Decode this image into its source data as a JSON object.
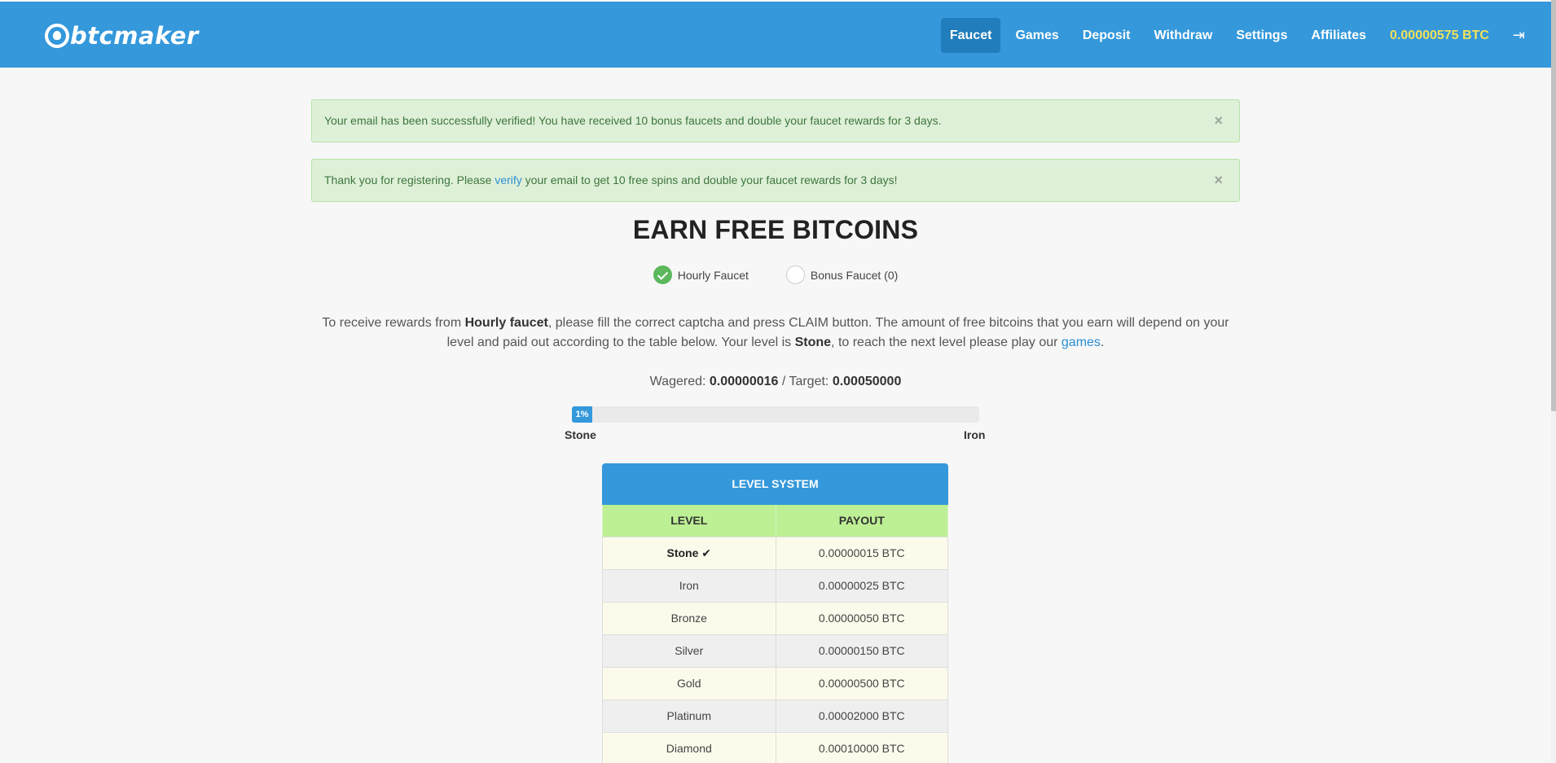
{
  "nav": {
    "logo_text": "btcmaker",
    "items": [
      {
        "label": "Faucet",
        "active": true
      },
      {
        "label": "Games",
        "active": false
      },
      {
        "label": "Deposit",
        "active": false
      },
      {
        "label": "Withdraw",
        "active": false
      },
      {
        "label": "Settings",
        "active": false
      },
      {
        "label": "Affiliates",
        "active": false
      }
    ],
    "balance": "0.00000575 BTC",
    "logout_icon": "sign-out-icon"
  },
  "alerts": {
    "verified": {
      "text": "Your email has been successfully verified! You have received 10 bonus faucets and double your faucet rewards for 3 days.",
      "close": "×"
    },
    "register": {
      "text_before": "Thank you for registering. Please ",
      "link": "verify",
      "text_after": " your email to get 10 free spins and double your faucet rewards for 3 days!",
      "close": "×"
    }
  },
  "title": "EARN FREE BITCOINS",
  "faucet_options": [
    {
      "label": "Hourly Faucet",
      "checked": true
    },
    {
      "label": "Bonus Faucet (0)",
      "checked": false
    }
  ],
  "description": {
    "p1": "To receive rewards from ",
    "b1": "Hourly faucet",
    "p2": ", please fill the correct captcha and press CLAIM button. The amount of free bitcoins that you earn will depend on your level and paid out according to the table below. Your level is ",
    "b2": "Stone",
    "p3": ", to reach the next level please play our ",
    "link": "games",
    "p4": "."
  },
  "wagered": {
    "label": "Wagered: ",
    "value": "0.00000016",
    "sep": " / Target: ",
    "target": "0.00050000"
  },
  "progress": {
    "percent_label": "1%",
    "fraction": 0.01,
    "from_level": "Stone",
    "to_level": "Iron"
  },
  "level_system": {
    "title": "LEVEL SYSTEM",
    "columns": [
      "LEVEL",
      "PAYOUT"
    ],
    "rows": [
      {
        "level": "Stone ✔",
        "payout": "0.00000015 BTC",
        "current": true
      },
      {
        "level": "Iron",
        "payout": "0.00000025 BTC",
        "current": false
      },
      {
        "level": "Bronze",
        "payout": "0.00000050 BTC",
        "current": false
      },
      {
        "level": "Silver",
        "payout": "0.00000150 BTC",
        "current": false
      },
      {
        "level": "Gold",
        "payout": "0.00000500 BTC",
        "current": false
      },
      {
        "level": "Platinum",
        "payout": "0.00002000 BTC",
        "current": false
      },
      {
        "level": "Diamond",
        "payout": "0.00010000 BTC",
        "current": false
      }
    ]
  },
  "colors": {
    "navbar": "#3498db",
    "nav_active": "#217dbb",
    "balance": "#f1e05a",
    "alert_bg": "#dff0d8",
    "table_head": "#bdf094"
  }
}
